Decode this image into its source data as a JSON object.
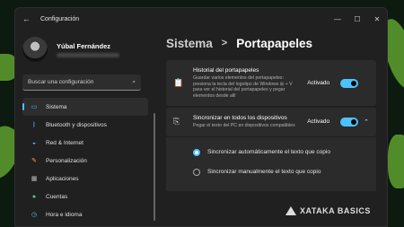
{
  "window": {
    "title": "Configuración"
  },
  "profile": {
    "name": "Yúbal Fernández"
  },
  "search": {
    "placeholder": "Buscar una configuración"
  },
  "sidebar": {
    "items": [
      {
        "label": "Sistema",
        "icon": "monitor-icon"
      },
      {
        "label": "Bluetooth y dispositivos",
        "icon": "bluetooth-icon"
      },
      {
        "label": "Red & Internet",
        "icon": "wifi-icon"
      },
      {
        "label": "Personalización",
        "icon": "brush-icon"
      },
      {
        "label": "Aplicaciones",
        "icon": "apps-icon"
      },
      {
        "label": "Cuentas",
        "icon": "account-icon"
      },
      {
        "label": "Hora e idioma",
        "icon": "globe-clock-icon"
      }
    ]
  },
  "breadcrumb": {
    "parent": "Sistema",
    "current": "Portapapeles"
  },
  "settings": [
    {
      "title": "Historial del portapapeles",
      "description": "Guardar varios elementos del portapapeles: presiona la tecla del logotipo de Windows ⊞ + V para ver el historial del portapapeles y pegar elementos desde allí",
      "status": "Activado"
    },
    {
      "title": "Sincronizar en todos los dispositivos",
      "description": "Pegar el texto del PC en dispositivos compatibles",
      "status": "Activado"
    }
  ],
  "sync_options": [
    {
      "label": "Sincronizar automáticamente el texto que copio",
      "selected": true
    },
    {
      "label": "Sincronizar manualmente el texto que copio",
      "selected": false
    }
  ],
  "watermark": "XATAKA BASICS",
  "colors": {
    "accent": "#4cc2ff",
    "background": "#202020",
    "card": "#2b2b2b"
  }
}
